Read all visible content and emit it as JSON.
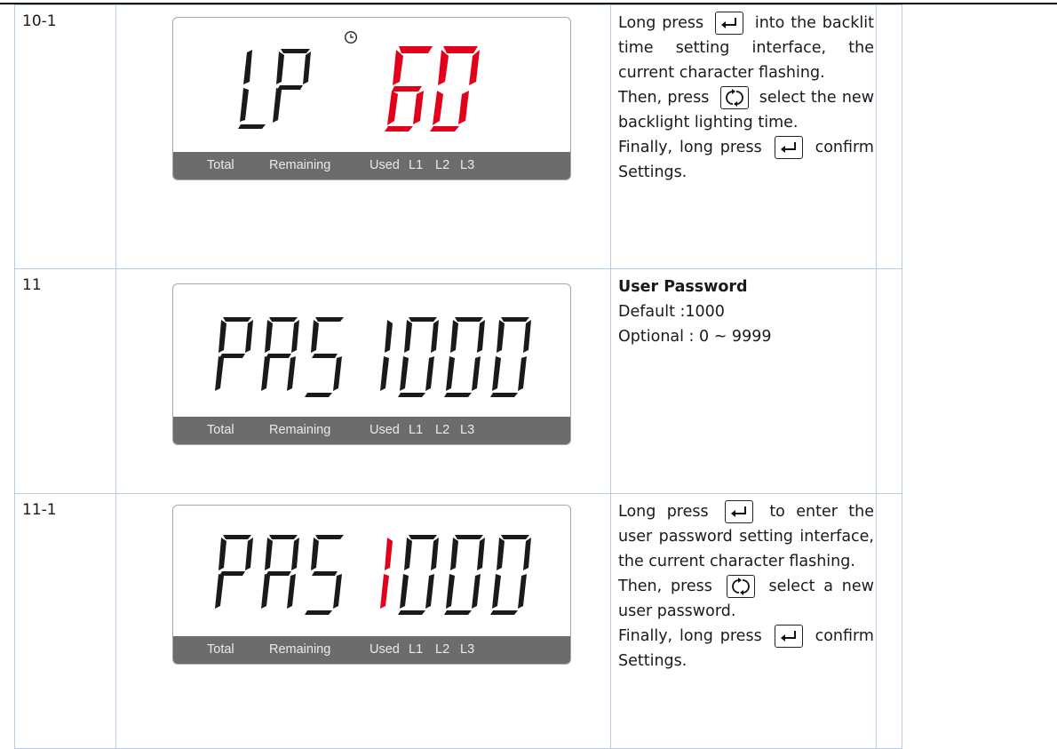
{
  "rows": [
    {
      "id": "10-1",
      "lcd": {
        "left": "LP",
        "right": "60",
        "labels": [
          "Total",
          "Remaining",
          "Used",
          "L1",
          "L2",
          "L3"
        ],
        "clock_icon": "clock-icon"
      },
      "desc": {
        "p1a": "Long press",
        "p1b": "into the backlit time setting interface, the current character flashing.",
        "p2a": "Then, press",
        "p2b": "select the new backlight lighting time.",
        "p3a": "Finally, long press",
        "p3b": "confirm Settings."
      }
    },
    {
      "id": "11",
      "lcd": {
        "left": "PAS",
        "right": "1000",
        "labels": [
          "Total",
          "Remaining",
          "Used",
          "L1",
          "L2",
          "L3"
        ]
      },
      "desc": {
        "title": "User Password",
        "l1": "Default :1000",
        "l2": "Optional : 0 ~ 9999"
      }
    },
    {
      "id": "11-1",
      "lcd": {
        "left": "PAS",
        "right": "1000",
        "labels": [
          "Total",
          "Remaining",
          "Used",
          "L1",
          "L2",
          "L3"
        ]
      },
      "desc": {
        "p1a": "Long press",
        "p1b": "to enter the user password setting interface, the current character flashing.",
        "p2a": "Then, press",
        "p2b": "select a new user password.",
        "p3a": "Finally, long press",
        "p3b": "confirm Settings."
      }
    }
  ],
  "icons": {
    "enter": "enter-key-icon",
    "cycle": "cycle-key-icon"
  },
  "colors": {
    "lcd_segment": "#1a1a1a",
    "lcd_flash": "#e3001b",
    "lcd_bar": "#6c6c6c",
    "table_border": "#b7cde3"
  }
}
